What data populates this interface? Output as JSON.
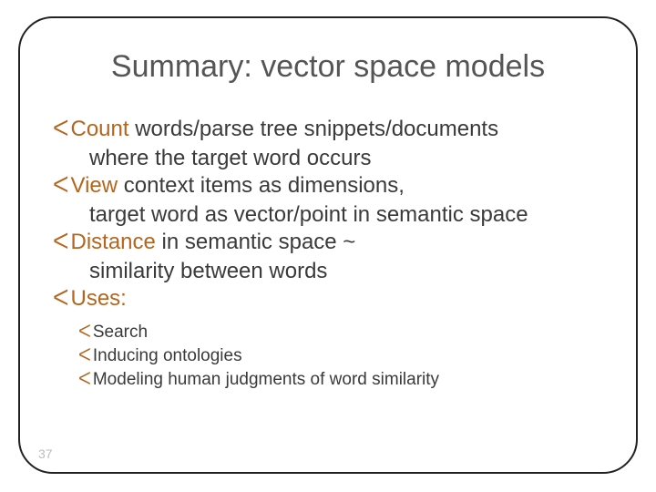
{
  "title": "Summary: vector space models",
  "bullets": [
    {
      "icon": "་",
      "lead": "Count",
      "rest": " words/parse tree snippets/documents",
      "cont": "where the target word occurs"
    },
    {
      "icon": "་",
      "lead": "View",
      "rest": " context items as dimensions,",
      "cont": "target word as vector/point in semantic space"
    },
    {
      "icon": "་",
      "lead": "Distance",
      "rest": " in semantic space ~",
      "cont": "similarity between words"
    },
    {
      "icon": "་",
      "lead": "Uses:",
      "rest": "",
      "cont": null
    }
  ],
  "sub_bullets": [
    {
      "icon": "་",
      "text": "Search"
    },
    {
      "icon": "་",
      "text": "Inducing ontologies"
    },
    {
      "icon": "་",
      "text": "Modeling human judgments of word similarity"
    }
  ],
  "page_number": "37"
}
